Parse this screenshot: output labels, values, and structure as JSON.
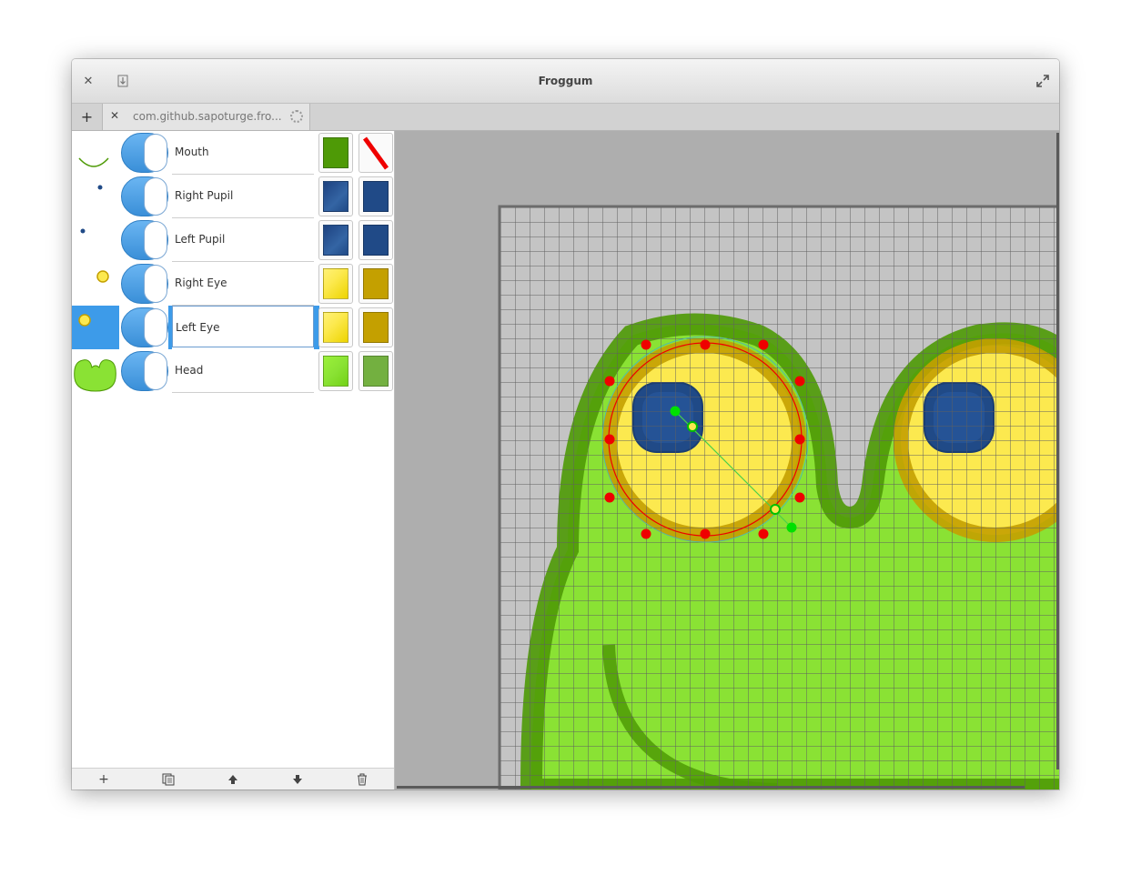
{
  "window": {
    "title": "Froggum"
  },
  "titlebar": {
    "close_icon": "close-icon",
    "pin_icon": "pin-icon",
    "maximize_icon": "maximize-icon"
  },
  "tabs": {
    "new_tab_icon": "plus-icon",
    "items": [
      {
        "label": "com.github.sapoturge.fro...",
        "loading": true
      }
    ]
  },
  "layers": [
    {
      "name": "Mouth",
      "visible": true,
      "selected": false,
      "fill": "#4e9a06",
      "stroke": "none-red-slash"
    },
    {
      "name": "Right Pupil",
      "visible": true,
      "selected": false,
      "fill": "#204a87",
      "stroke": "#204a87"
    },
    {
      "name": "Left Pupil",
      "visible": true,
      "selected": false,
      "fill": "#204a87",
      "stroke": "#204a87"
    },
    {
      "name": "Right Eye",
      "visible": true,
      "selected": false,
      "fill": "#fce94f",
      "stroke": "#c4a000"
    },
    {
      "name": "Left Eye",
      "visible": true,
      "selected": true,
      "fill": "#fce94f",
      "stroke": "#c4a000"
    },
    {
      "name": "Head",
      "visible": true,
      "selected": false,
      "fill": "#8ae234",
      "stroke": "#73b040"
    }
  ],
  "toolbar": {
    "add_icon": "plus-icon",
    "duplicate_icon": "duplicate-icon",
    "move_up_icon": "arrow-up-icon",
    "move_down_icon": "arrow-down-icon",
    "delete_icon": "trash-icon"
  },
  "colors": {
    "accent": "#3d9be9",
    "frog_green": "#8ae234",
    "frog_outline": "#4e9a06",
    "eye_yellow": "#fce94f",
    "eye_ring": "#c4a000",
    "pupil_blue": "#204a87",
    "handle_red": "#ef0000",
    "handle_green": "#00e000"
  }
}
